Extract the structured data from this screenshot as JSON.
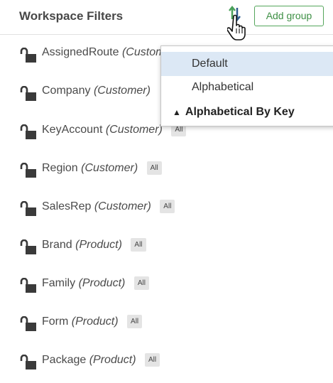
{
  "header": {
    "title": "Workspace Filters",
    "add_group_label": "Add group"
  },
  "colors": {
    "accent": "#55a65c",
    "sort_icon_up": "#4aa05a",
    "sort_icon_down": "#2f5b8e",
    "menu_highlight": "#dce8f5"
  },
  "filters": [
    {
      "name": "AssignedRoute",
      "category": "(Customer)",
      "badge": ""
    },
    {
      "name": "Company",
      "category": "(Customer)",
      "badge": ""
    },
    {
      "name": "KeyAccount",
      "category": "(Customer)",
      "badge": "All"
    },
    {
      "name": "Region",
      "category": "(Customer)",
      "badge": "All"
    },
    {
      "name": "SalesRep",
      "category": "(Customer)",
      "badge": "All"
    },
    {
      "name": "Brand",
      "category": "(Product)",
      "badge": "All"
    },
    {
      "name": "Family",
      "category": "(Product)",
      "badge": "All"
    },
    {
      "name": "Form",
      "category": "(Product)",
      "badge": "All"
    },
    {
      "name": "Package",
      "category": "(Product)",
      "badge": "All"
    }
  ],
  "sort_menu": {
    "items": [
      {
        "label": "Default",
        "highlighted": true
      },
      {
        "label": "Alphabetical",
        "highlighted": false
      },
      {
        "label": "Alphabetical By Key",
        "selected_marker": "▲"
      }
    ]
  }
}
